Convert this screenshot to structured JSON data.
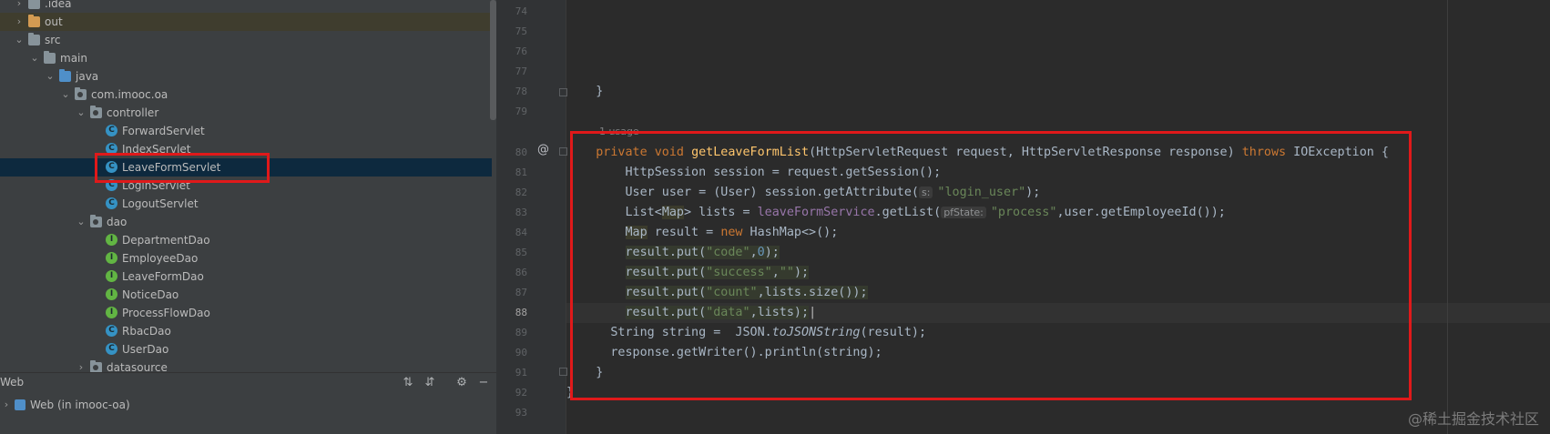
{
  "project_tree": [
    {
      "label": ".idea",
      "indent": 0,
      "chevron": "›",
      "icon": "folder-icon",
      "style": ""
    },
    {
      "label": "out",
      "indent": 0,
      "chevron": "›",
      "icon": "folder-orange-icon",
      "style": "out"
    },
    {
      "label": "src",
      "indent": 0,
      "chevron": "⌄",
      "icon": "folder-icon",
      "style": ""
    },
    {
      "label": "main",
      "indent": 1,
      "chevron": "⌄",
      "icon": "folder-icon",
      "style": ""
    },
    {
      "label": "java",
      "indent": 2,
      "chevron": "⌄",
      "icon": "folder-blue-icon",
      "style": ""
    },
    {
      "label": "com.imooc.oa",
      "indent": 3,
      "chevron": "⌄",
      "icon": "package-icon",
      "style": ""
    },
    {
      "label": "controller",
      "indent": 4,
      "chevron": "⌄",
      "icon": "package-icon",
      "style": ""
    },
    {
      "label": "ForwardServlet",
      "indent": 5,
      "chevron": "",
      "icon": "class-icon",
      "style": ""
    },
    {
      "label": "IndexServlet",
      "indent": 5,
      "chevron": "",
      "icon": "class-icon",
      "style": ""
    },
    {
      "label": "LeaveFormServlet",
      "indent": 5,
      "chevron": "",
      "icon": "class-icon",
      "style": "sel"
    },
    {
      "label": "LoginServlet",
      "indent": 5,
      "chevron": "",
      "icon": "class-icon",
      "style": ""
    },
    {
      "label": "LogoutServlet",
      "indent": 5,
      "chevron": "",
      "icon": "class-icon",
      "style": ""
    },
    {
      "label": "dao",
      "indent": 4,
      "chevron": "⌄",
      "icon": "package-icon",
      "style": ""
    },
    {
      "label": "DepartmentDao",
      "indent": 5,
      "chevron": "",
      "icon": "interface-icon",
      "style": ""
    },
    {
      "label": "EmployeeDao",
      "indent": 5,
      "chevron": "",
      "icon": "interface-icon",
      "style": ""
    },
    {
      "label": "LeaveFormDao",
      "indent": 5,
      "chevron": "",
      "icon": "interface-icon",
      "style": ""
    },
    {
      "label": "NoticeDao",
      "indent": 5,
      "chevron": "",
      "icon": "interface-icon",
      "style": ""
    },
    {
      "label": "ProcessFlowDao",
      "indent": 5,
      "chevron": "",
      "icon": "interface-icon",
      "style": ""
    },
    {
      "label": "RbacDao",
      "indent": 5,
      "chevron": "",
      "icon": "class-icon",
      "style": ""
    },
    {
      "label": "UserDao",
      "indent": 5,
      "chevron": "",
      "icon": "class-icon",
      "style": ""
    },
    {
      "label": "datasource",
      "indent": 4,
      "chevron": "›",
      "icon": "package-icon",
      "style": ""
    }
  ],
  "web_panel": {
    "title": "Web",
    "item": "Web (in imooc-oa)",
    "toolbar_icons": [
      "expand-all-icon",
      "collapse-all-icon",
      "settings-gear-icon",
      "hide-minus-icon"
    ]
  },
  "editor": {
    "line_numbers": [
      "74",
      "75",
      "76",
      "77",
      "78",
      "79",
      "80",
      "81",
      "82",
      "83",
      "84",
      "85",
      "86",
      "87",
      "88",
      "89",
      "90",
      "91",
      "92",
      "93"
    ],
    "current_line": "88",
    "usage_hint": "1 usage",
    "inlay_hints": {
      "s": "s:",
      "pfState": "pfState:"
    },
    "code": {
      "l78": "    }",
      "l80_private": "private",
      "l80_void": "void",
      "l80_name": "getLeaveFormList",
      "l80_params": "(HttpServletRequest request, HttpServletResponse response) ",
      "l80_throws": "throws",
      "l80_ex": " IOException {",
      "l81": "HttpSession session = request.getSession();",
      "l82_a": "User user = (User) session.getAttribute(",
      "l82_str": "\"login_user\"",
      "l82_b": ");",
      "l83_a": "List<",
      "l83_map": "Map",
      "l83_b": "> lists = ",
      "l83_field": "leaveFormService",
      "l83_c": ".getList(",
      "l83_str": "\"process\"",
      "l83_d": ",user.getEmployeeId());",
      "l84_map": "Map",
      "l84_a": " result = ",
      "l84_new": "new",
      "l84_b": " HashMap<>();",
      "put_call": "result.put(",
      "l85_str": "\"code\"",
      "l85_num": "0",
      "l85_end": ");",
      "l86_str": "\"success\"",
      "l86_str2": "\"\"",
      "l86_end": ");",
      "l87_str": "\"count\"",
      "l87_end": ",lists.size());",
      "l88_str": "\"data\"",
      "l88_end": ",lists);",
      "l89_a": "String string =  JSON.",
      "l89_method": "toJSONString",
      "l89_b": "(result);",
      "l90": "response.getWriter().println(string);",
      "l91": "    }",
      "l92": "}"
    }
  },
  "watermark": "@稀土掘金技术社区",
  "colors": {
    "highlight_box": "#e0191a",
    "keyword": "#cc7832",
    "method_decl": "#ffc66d",
    "string": "#6a8759",
    "number": "#6897bb",
    "field": "#9876aa"
  }
}
